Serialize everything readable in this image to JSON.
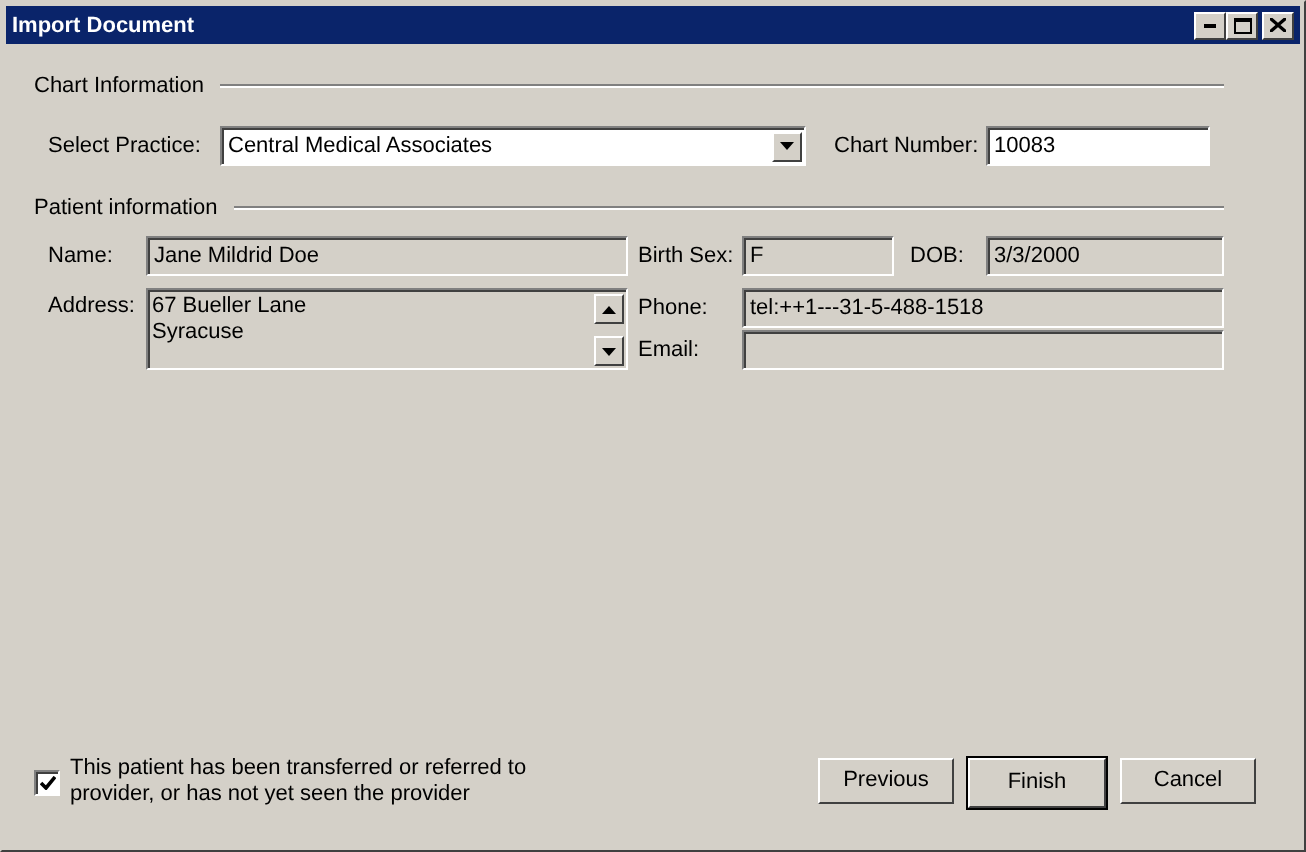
{
  "window": {
    "title": "Import Document"
  },
  "chart_section": {
    "heading": "Chart Information",
    "practice_label": "Select Practice:",
    "practice_value": "Central Medical Associates",
    "chart_number_label": "Chart Number:",
    "chart_number_value": "10083"
  },
  "patient_section": {
    "heading": "Patient information",
    "name_label": "Name:",
    "name_value": "Jane Mildrid Doe",
    "birth_sex_label": "Birth Sex:",
    "birth_sex_value": "F",
    "dob_label": "DOB:",
    "dob_value": "3/3/2000",
    "address_label": "Address:",
    "address_lines": [
      "67 Bueller Lane",
      "Syracuse"
    ],
    "phone_label": "Phone:",
    "phone_value": "tel:++1---31-5-488-1518",
    "email_label": "Email:"
  },
  "transfer_checkbox": {
    "label": "This patient has been transferred or referred to provider, or has not yet seen the provider",
    "checked": true
  },
  "buttons": [
    {
      "label": "Previous",
      "default": false
    },
    {
      "label": "Finish",
      "default": true
    },
    {
      "label": "Cancel",
      "default": false
    }
  ]
}
